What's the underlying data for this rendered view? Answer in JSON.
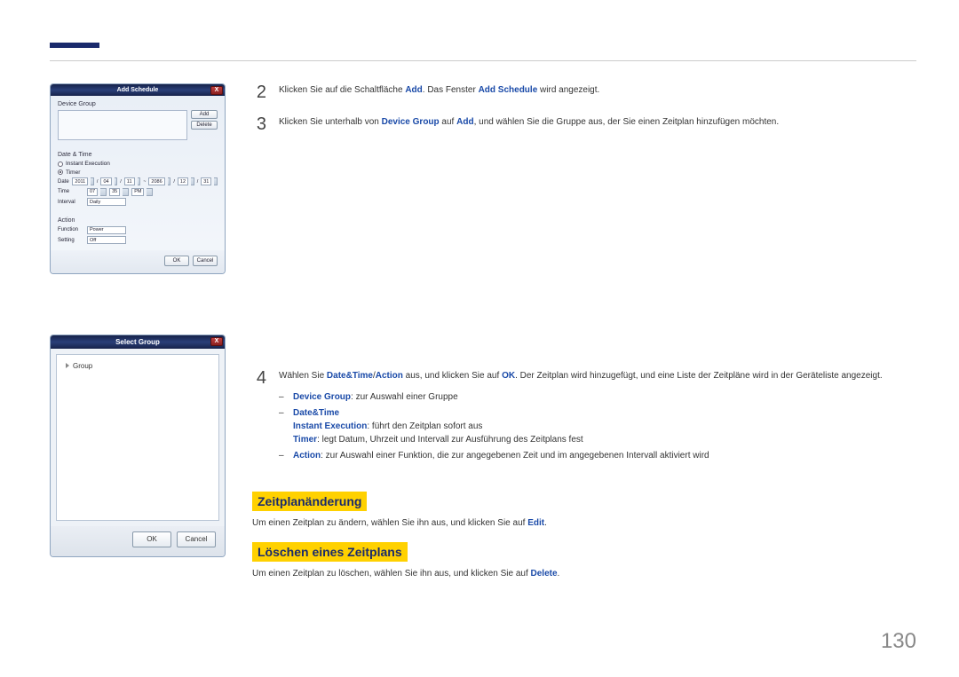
{
  "accent_color": "#1a2a6c",
  "highlight_color": "#ffd100",
  "link_color": "#1a4aa8",
  "page_number": "130",
  "dialog_add_schedule": {
    "title": "Add Schedule",
    "close": "X",
    "device_group_label": "Device Group",
    "add_btn": "Add",
    "delete_btn": "Delete",
    "date_time_label": "Date & Time",
    "instant_exec": "Instant Execution",
    "timer": "Timer",
    "date_label": "Date",
    "date_from_y": "2011",
    "date_from_m": "04",
    "date_from_d": "11",
    "date_to_y": "2086",
    "date_to_m": "12",
    "date_to_d": "31",
    "time_label": "Time",
    "time_h": "07",
    "time_m": "35",
    "time_ampm": "PM",
    "interval_label": "Interval",
    "interval_value": "Daily",
    "action_label": "Action",
    "function_label": "Function",
    "function_value": "Power",
    "setting_label": "Setting",
    "setting_value": "Off",
    "ok": "OK",
    "cancel": "Cancel"
  },
  "dialog_select_group": {
    "title": "Select Group",
    "close": "X",
    "root_node": "Group",
    "ok": "OK",
    "cancel": "Cancel"
  },
  "steps": {
    "s2_num": "2",
    "s2_a": "Klicken Sie auf die Schaltfläche ",
    "s2_b": "Add",
    "s2_c": ". Das Fenster ",
    "s2_d": "Add Schedule",
    "s2_e": " wird angezeigt.",
    "s3_num": "3",
    "s3_a": "Klicken Sie unterhalb von ",
    "s3_b": "Device Group",
    "s3_c": " auf ",
    "s3_d": "Add",
    "s3_e": ", und wählen Sie die Gruppe aus, der Sie einen Zeitplan hinzufügen möchten.",
    "s4_num": "4",
    "s4_a": "Wählen Sie ",
    "s4_b": "Date&Time",
    "s4_c": "/",
    "s4_d": "Action",
    "s4_e": " aus, und klicken Sie auf ",
    "s4_f": "OK",
    "s4_g": ". Der Zeitplan wird hinzugefügt, und eine Liste der Zeitpläne wird in der Geräteliste angezeigt.",
    "sub_dg_label": "Device Group",
    "sub_dg_text": ": zur Auswahl einer Gruppe",
    "sub_dt_label": "Date&Time",
    "sub_ie_label": "Instant Execution",
    "sub_ie_text": ": führt den Zeitplan sofort aus",
    "sub_timer_label": "Timer",
    "sub_timer_text": ": legt Datum, Uhrzeit und Intervall zur Ausführung des Zeitplans fest",
    "sub_action_label": "Action",
    "sub_action_text": ": zur Auswahl einer Funktion, die zur angegebenen Zeit und im angegebenen Intervall aktiviert wird"
  },
  "sections": {
    "edit_heading": "Zeitplanänderung",
    "edit_text_a": "Um einen Zeitplan zu ändern, wählen Sie ihn aus, und klicken Sie auf ",
    "edit_text_b": "Edit",
    "edit_text_c": ".",
    "delete_heading": "Löschen eines Zeitplans",
    "delete_text_a": "Um einen Zeitplan zu löschen, wählen Sie ihn aus, und klicken Sie auf ",
    "delete_text_b": "Delete",
    "delete_text_c": "."
  }
}
